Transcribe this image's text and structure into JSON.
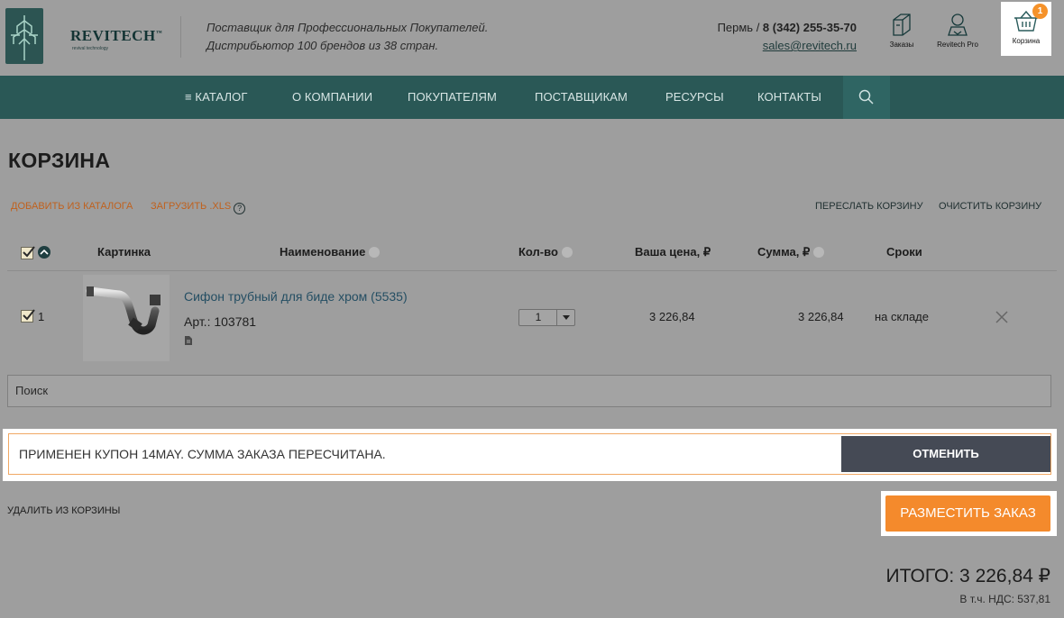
{
  "header": {
    "brand": "REVITECH",
    "brand_tm": "™",
    "brand_sub": "revival technology",
    "tagline_1": "Поставщик для Профессиональных Покупателей.",
    "tagline_2": "Дистрибьютор 100 брендов из 38 стран.",
    "city": "Пермь",
    "phone": "8 (342) 255-35-70",
    "email": "sales@revitech.ru",
    "icons": {
      "orders": "Заказы",
      "pro": "Revitech Pro",
      "cart": "Корзина",
      "cart_count": "1"
    }
  },
  "nav": {
    "items": [
      "≡ КАТАЛОГ",
      "О КОМПАНИИ",
      "ПОКУПАТЕЛЯМ",
      "ПОСТАВЩИКАМ",
      "РЕСУРСЫ",
      "КОНТАКТЫ"
    ]
  },
  "cart": {
    "title": "КОРЗИНА",
    "add_from_catalog": "ДОБАВИТЬ ИЗ КАТАЛОГА",
    "upload_xls": "ЗАГРУЗИТЬ .XLS",
    "help": "?",
    "forward_cart": "ПЕРЕСЛАТЬ КОРЗИНУ",
    "clear_cart": "ОЧИСТИТЬ КОРЗИНУ",
    "columns": {
      "image": "Картинка",
      "name": "Наименование",
      "qty": "Кол-во",
      "price": "Ваша цена, ₽",
      "sum": "Сумма, ₽",
      "terms": "Сроки"
    },
    "items": [
      {
        "num": "1",
        "name": "Сифон трубный для биде хром (5535)",
        "article": "Арт.: 103781",
        "qty": "1",
        "price": "3 226,84",
        "sum": "3 226,84",
        "terms": "на складе"
      }
    ],
    "search_placeholder": "Поиск",
    "coupon_message": "ПРИМЕНЕН КУПОН 14MAY. СУММА ЗАКАЗА ПЕРЕСЧИТАНА.",
    "coupon_cancel": "ОТМЕНИТЬ",
    "remove_selected": "УДАЛИТЬ ИЗ КОРЗИНЫ",
    "place_order": "РАЗМЕСТИТЬ ЗАКАЗ",
    "total": "ИТОГО: 3 226,84 ₽",
    "vat": "В т.ч. НДС: 537,81"
  }
}
